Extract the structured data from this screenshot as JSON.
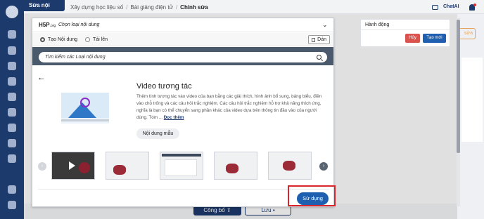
{
  "topbar": {
    "section": "Sửa nội dung",
    "breadcrumbs": [
      "Xây dựng học liệu số",
      "Bài giảng điện tử",
      "Chỉnh sửa"
    ],
    "chat_label": "ChatAI"
  },
  "background": {
    "side_button": "sửa",
    "publish_label": "Công bố",
    "save_label": "Lưu"
  },
  "actions_panel": {
    "title": "Hành động",
    "cancel_label": "Hủy",
    "create_label": "Tạo mới"
  },
  "modal": {
    "logo": "H5P",
    "logo_suffix": ".org",
    "title": "Chọn loại nội dung",
    "tabs": [
      "Tạo Nội dung",
      "Tải lên"
    ],
    "paste_label": "Dán",
    "search_placeholder": "Tìm kiếm các Loại nội dung",
    "content": {
      "title": "Video tương tác",
      "description": "Thêm tính tương tác vào video của bạn bằng các giải thích, hình ảnh bổ sung, bảng biểu, điền vào chỗ trống và các câu hỏi trắc nghiệm. Các câu hỏi trắc nghiệm hỗ trợ khả năng thích ứng, nghĩa là bạn có thể chuyển sang phần khác của video dựa trên thông tin đầu vào của người dùng. Tóm ...",
      "read_more": "Đọc thêm",
      "sample_label": "Nội dung mẫu"
    },
    "use_label": "Sử dụng"
  },
  "colors": {
    "sidebar": "#1d3a6d",
    "primary": "#1f5fb0",
    "danger": "#d9534f",
    "highlight": "#d9262c"
  }
}
